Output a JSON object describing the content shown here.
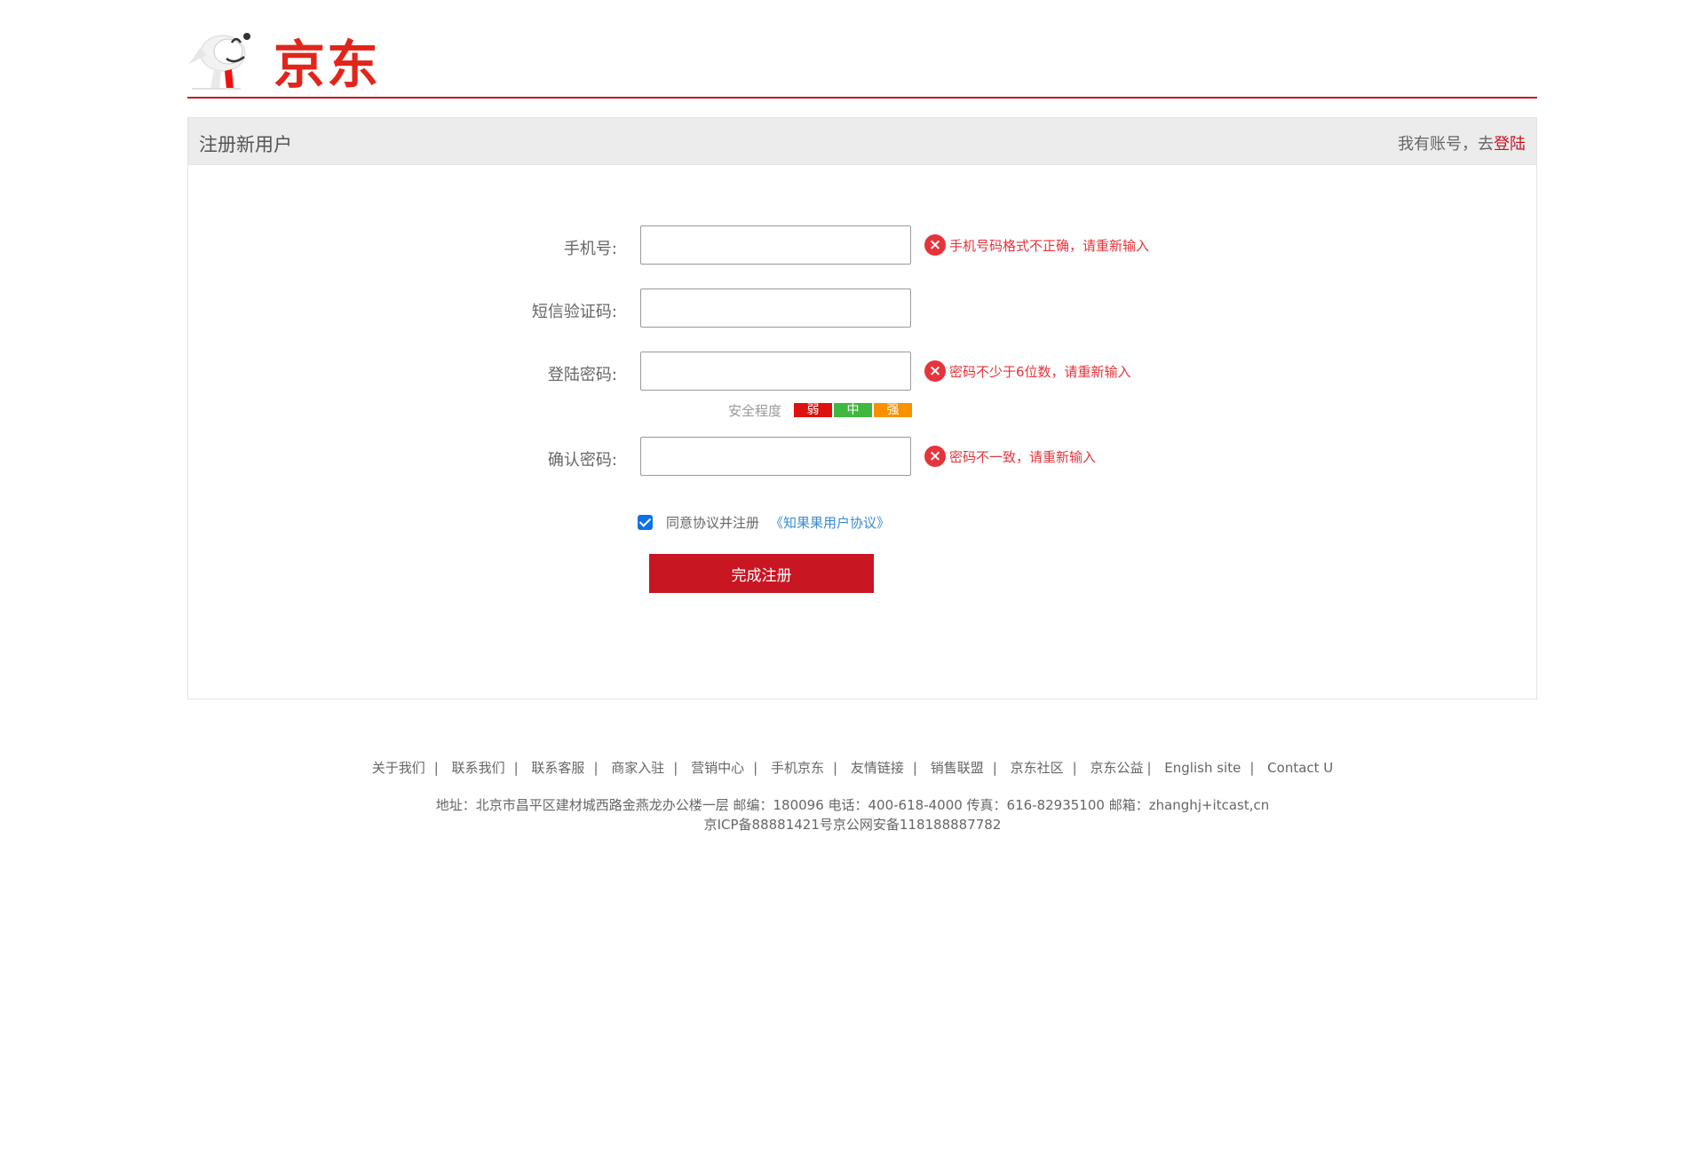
{
  "brand": {
    "logo_text": "京东",
    "accent_color": "#c81623"
  },
  "register": {
    "title": "注册新用户",
    "login_prompt": "我有账号，去",
    "login_link": "登陆",
    "fields": [
      {
        "label": "手机号:",
        "value": "",
        "error": "手机号码格式不正确，请重新输入"
      },
      {
        "label": "短信验证码:",
        "value": "",
        "error": ""
      },
      {
        "label": "登陆密码:",
        "value": "",
        "error": "密码不少于6位数，请重新输入"
      },
      {
        "label": "确认密码:",
        "value": "",
        "error": "密码不一致，请重新输入"
      }
    ],
    "strength": {
      "label": "安全程度",
      "levels": [
        "弱",
        "中",
        "强"
      ]
    },
    "agree": {
      "checked": true,
      "text": "同意协议并注册",
      "link": "《知果果用户协议》"
    },
    "submit_label": "完成注册"
  },
  "footer": {
    "links": [
      "关于我们",
      "联系我们",
      "联系客服",
      "商家入驻",
      "营销中心",
      "手机京东",
      "友情链接",
      "销售联盟",
      "京东社区",
      "京东公益",
      "English site",
      "Contact U"
    ],
    "address": "地址：北京市昌平区建材城西路金燕龙办公楼一层 邮编：180096 电话：400-618-4000 传真：616-82935100 邮箱：zhanghj+itcast,cn",
    "icp": "京ICP备88881421号京公网安备118188887782"
  }
}
